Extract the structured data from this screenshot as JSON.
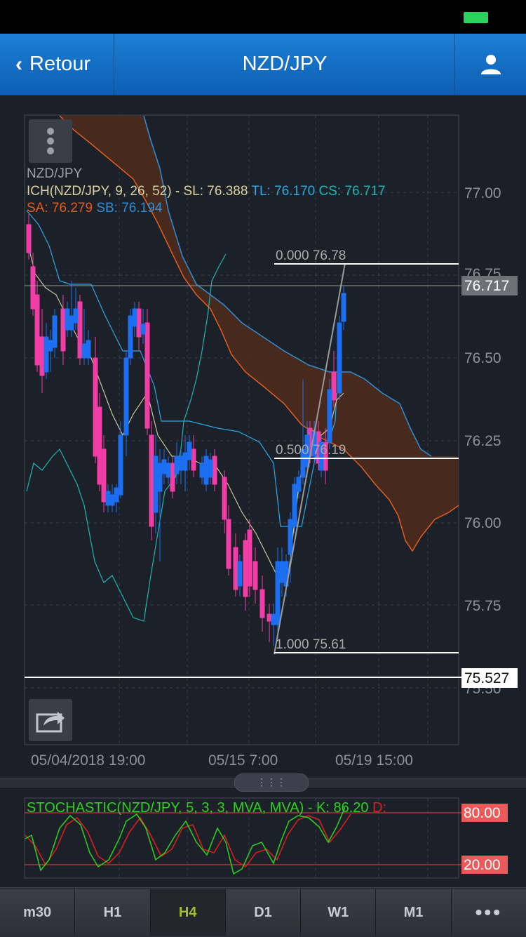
{
  "nav": {
    "back_label": "Retour",
    "title": "NZD/JPY"
  },
  "main_chart": {
    "symbol_label": "NZD/JPY",
    "ichimoku": {
      "label": "ICH(NZD/JPY, 9, 26, 52) - SL:",
      "sl_value": "76.388",
      "tl_label": "TL:",
      "tl_value": "76.170",
      "cs_label": "CS:",
      "cs_value": "76.717",
      "sa_label": "SA:",
      "sa_value": "76.279",
      "sb_label": "SB:",
      "sb_value": "76.194"
    },
    "price_ticks": [
      "77.00",
      "76.50",
      "76.25",
      "76.00",
      "75.75"
    ],
    "partial_ticks": [
      "76.75",
      "75.50"
    ],
    "current_price": "76.717",
    "horizontal_line_price": "75.527",
    "fibonacci": [
      {
        "label": "0.000 76.78"
      },
      {
        "label": "0.500 76.19"
      },
      {
        "label": "1.000 75.61"
      }
    ],
    "date_labels": [
      "05/04/2018 19:00",
      "05/15 7:00",
      "05/19 15:00"
    ]
  },
  "stochastic": {
    "label": "STOCHASTIC(NZD/JPY, 5, 3, 3, MVA, MVA) - K: 86.20",
    "d_label": "D:",
    "upper_level": "80.00",
    "lower_level": "20.00"
  },
  "tabs": [
    "m30",
    "H1",
    "H4",
    "D1",
    "W1",
    "M1",
    "•••"
  ],
  "active_tab": "H4",
  "colors": {
    "bull_candle": "#1d6ff2",
    "bear_candle": "#f23ca6",
    "cloud": "#4a2a1e",
    "senkou_a": "#e35d1d",
    "senkou_b": "#2f8fd6",
    "tenkan": "#c8c59a",
    "kijun": "#2aa8e6",
    "chikou": "#1fb4b4",
    "stoch_k": "#2bd31e",
    "stoch_d": "#e01e1e",
    "nav": "#1377d2",
    "active_tab": "#9ec02a"
  }
}
